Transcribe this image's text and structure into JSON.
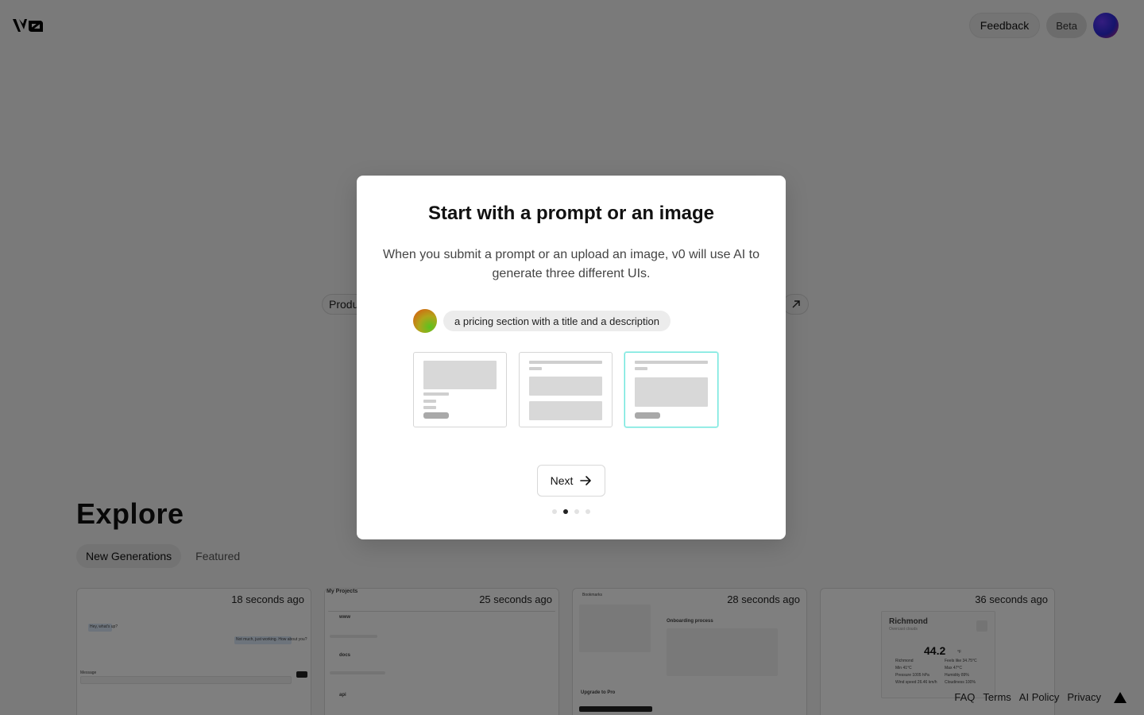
{
  "header": {
    "feedback_label": "Feedback",
    "beta_label": "Beta"
  },
  "background": {
    "prompt_chip_left": "Produ"
  },
  "explore": {
    "title": "Explore",
    "tabs": [
      {
        "label": "New Generations",
        "active": true
      },
      {
        "label": "Featured",
        "active": false
      }
    ],
    "cards": [
      {
        "time": "18 seconds ago"
      },
      {
        "time": "25 seconds ago"
      },
      {
        "time": "28 seconds ago"
      },
      {
        "time": "36 seconds ago"
      }
    ],
    "card1": {
      "msg_in": "Hey, what's up?",
      "msg_out": "Not much, just working. How about you?",
      "message_label": "Message",
      "send_label": "Send"
    },
    "card2": {
      "title": "My Projects",
      "items": [
        "www",
        "docs",
        "api"
      ]
    },
    "card3": {
      "nav": "Bookmarks",
      "heading": "Onboarding process",
      "upgrade": "Upgrade to Pro"
    },
    "card4": {
      "city": "Richmond",
      "desc": "Overcast clouds",
      "temp": "44.2",
      "unit": "°F",
      "stats_left": [
        "Richmond",
        "Min 41°C",
        "Pressure 1005 hPa",
        "Wind speed 26.46 km/h"
      ],
      "stats_right": [
        "Feels like 34.75°C",
        "Max 47°C",
        "Humidity 89%",
        "Cloudiness 100%"
      ]
    }
  },
  "footer": {
    "links": [
      "FAQ",
      "Terms",
      "AI Policy",
      "Privacy"
    ]
  },
  "modal": {
    "title": "Start with a prompt or an image",
    "description": "When you submit a prompt or an upload an image, v0 will use AI to generate three different UIs.",
    "demo_prompt": "a pricing section with a title and a description",
    "next_label": "Next",
    "step_count": 4,
    "current_step": 2
  },
  "colors": {
    "overlay": "#000000",
    "selected_variant_border": "#6fe6dd"
  }
}
